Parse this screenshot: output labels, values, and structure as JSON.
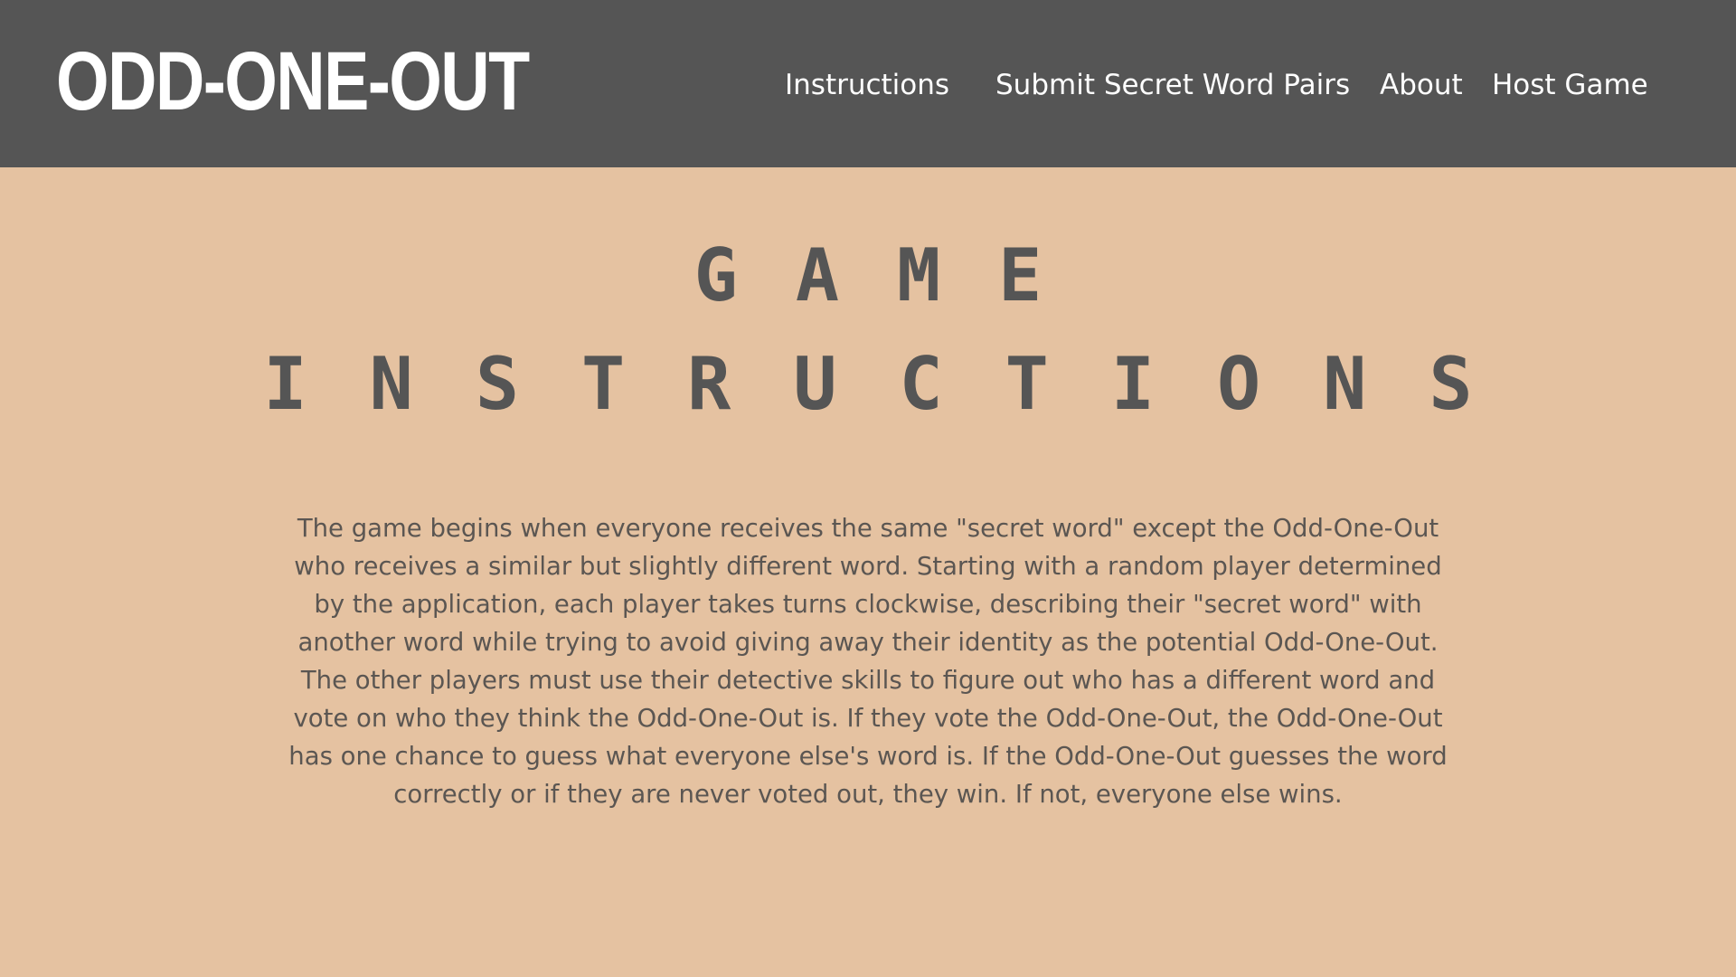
{
  "header": {
    "logo": "ODD-ONE-OUT",
    "nav": {
      "instructions": "Instructions",
      "submit": "Submit Secret Word Pairs",
      "about": "About",
      "host": "Host Game"
    }
  },
  "main": {
    "title_line_1": "GAME",
    "title_line_2": "INSTRUCTIONS",
    "instructions_text": "The game begins when everyone receives the same \"secret word\" except the Odd-One-Out who receives a similar but slightly different word. Starting with a random player determined by the application, each player takes turns clockwise, describing their \"secret word\" with another word while trying to avoid giving away their identity as the potential Odd-One-Out. The other players must use their detective skills to figure out who has a different word and vote on who they think the Odd-One-Out is. If they vote the Odd-One-Out, the Odd-One-Out has one chance to guess what everyone else's word is. If the Odd-One-Out guesses the word correctly or if they are never voted out, they win. If not, everyone else wins."
  },
  "colors": {
    "header_bg": "#555555",
    "page_bg": "#e5c2a1",
    "text": "#555555",
    "nav_text": "#ffffff"
  }
}
